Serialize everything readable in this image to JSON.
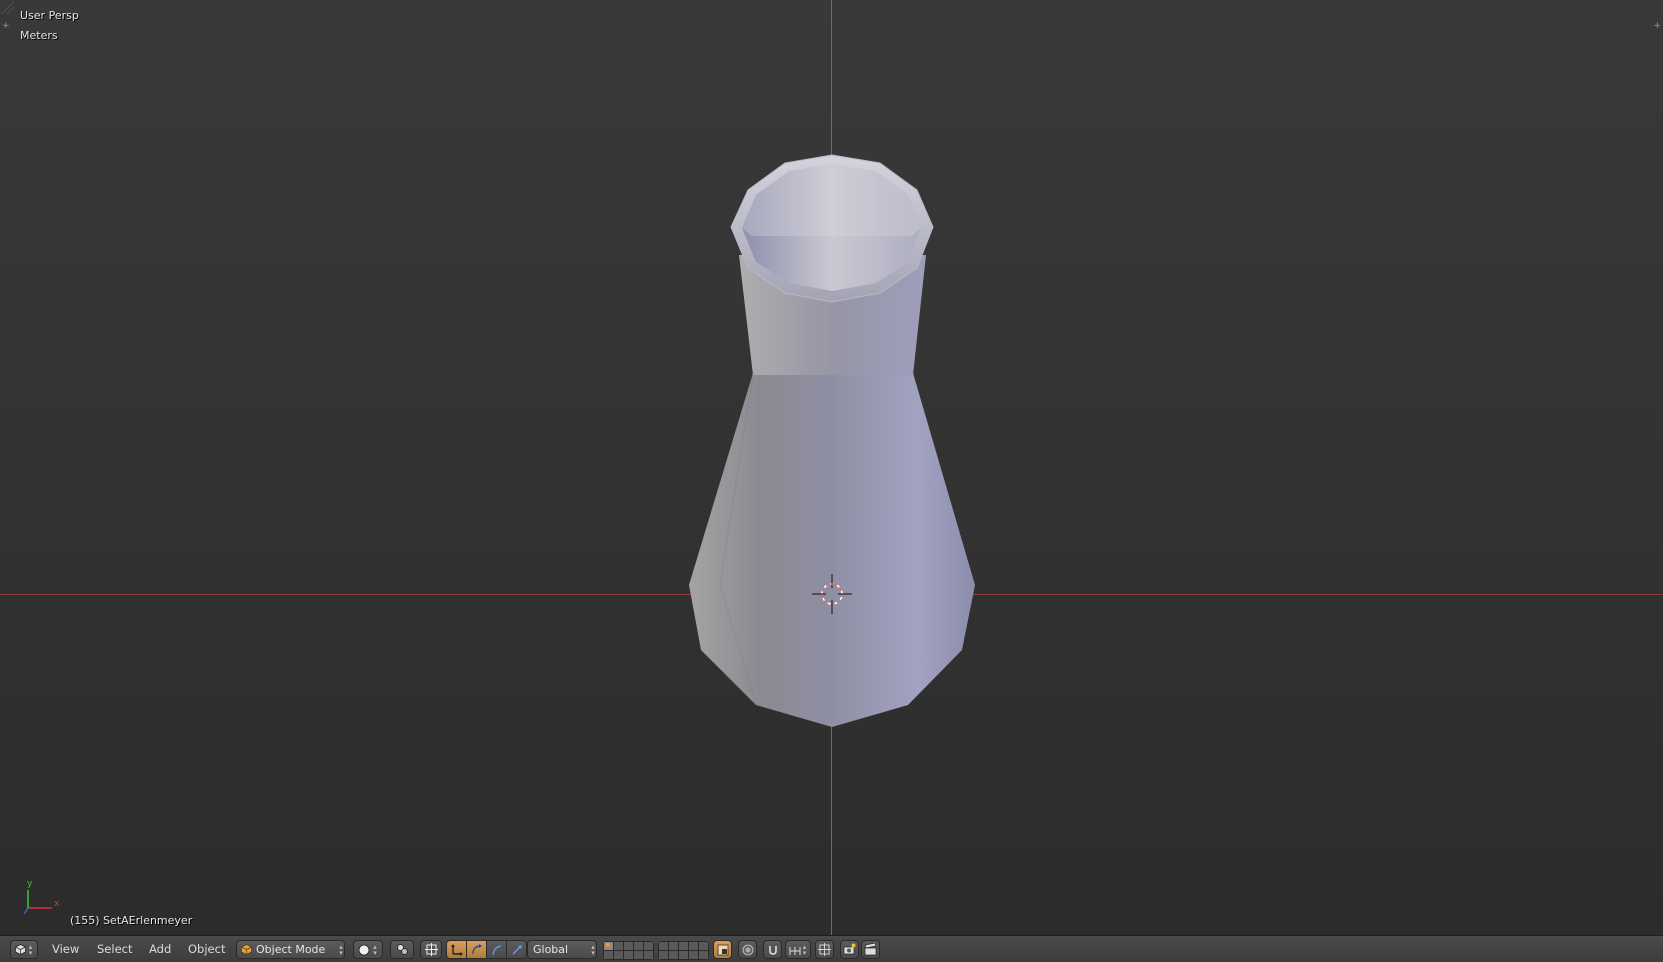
{
  "viewport": {
    "view_name": "User Persp",
    "units": "Meters",
    "object_info": "(155) SetAErlenmeyer",
    "axis_gizmo": {
      "x_label": "x",
      "y_label": "y"
    }
  },
  "header": {
    "editor_type_icon": "3d-view-icon",
    "menus": [
      {
        "id": "view",
        "label": "View"
      },
      {
        "id": "select",
        "label": "Select"
      },
      {
        "id": "add",
        "label": "Add"
      },
      {
        "id": "object",
        "label": "Object"
      }
    ],
    "mode": {
      "label": "Object Mode",
      "icon": "cube-icon"
    },
    "viewport_shading_icon": "solid-sphere-icon",
    "pivot_icon": "pivot-point-icon",
    "manipulator_icons": [
      "manipulator-toggle-icon",
      "translate-icon",
      "rotate-icon",
      "scale-icon"
    ],
    "transform_orientation": "Global",
    "layers": {
      "first_group_active_index": 0
    },
    "colors": {
      "active_button": "#d8a05a",
      "x_axis": "#8d3b3b",
      "y_axis": "#3b8d3b",
      "flask_body": "#9a9ab8"
    }
  }
}
